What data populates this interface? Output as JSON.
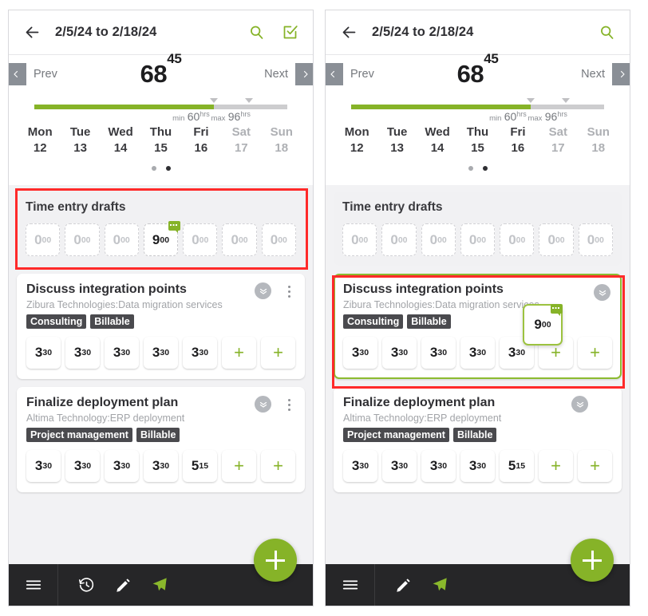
{
  "colors": {
    "accent_green": "#86b328",
    "highlight_red": "#ff2a2a",
    "drop_border_green": "#8cbb2f",
    "navbar_dark": "#262628",
    "tag_dark": "#4a4a4e"
  },
  "panels": [
    {
      "id": "left",
      "appbar": {
        "back_icon": "arrow-left-icon",
        "title": "2/5/24 to 2/18/24",
        "actions": [
          "search-icon",
          "submit-check-icon"
        ]
      },
      "summary": {
        "prev_label": "Prev",
        "next_label": "Next",
        "total_hours": "68",
        "total_minutes": "45",
        "progress_percent": 71,
        "min_prefix": "min",
        "min_value": "60",
        "min_unit": "hrs",
        "max_prefix": "max",
        "max_value": "96",
        "max_unit": "hrs",
        "days": [
          {
            "dow": "Mon",
            "num": "12",
            "weekend": false
          },
          {
            "dow": "Tue",
            "num": "13",
            "weekend": false
          },
          {
            "dow": "Wed",
            "num": "14",
            "weekend": false
          },
          {
            "dow": "Thu",
            "num": "15",
            "weekend": false
          },
          {
            "dow": "Fri",
            "num": "16",
            "weekend": false
          },
          {
            "dow": "Sat",
            "num": "17",
            "weekend": true
          },
          {
            "dow": "Sun",
            "num": "18",
            "weekend": true
          }
        ],
        "page_dots": 2,
        "active_dot": 1
      },
      "drafts": {
        "title": "Time entry drafts",
        "chips": [
          {
            "hours": "0",
            "minutes": "00",
            "filled": false,
            "badge": false
          },
          {
            "hours": "0",
            "minutes": "00",
            "filled": false,
            "badge": false
          },
          {
            "hours": "0",
            "minutes": "00",
            "filled": false,
            "badge": false
          },
          {
            "hours": "9",
            "minutes": "00",
            "filled": true,
            "badge": true
          },
          {
            "hours": "0",
            "minutes": "00",
            "filled": false,
            "badge": false
          },
          {
            "hours": "0",
            "minutes": "00",
            "filled": false,
            "badge": false
          },
          {
            "hours": "0",
            "minutes": "00",
            "filled": false,
            "badge": false
          }
        ]
      },
      "cards": [
        {
          "title": "Discuss integration points",
          "subtitle": "Zibura Technologies:Data migration services",
          "tags": [
            "Consulting",
            "Billable"
          ],
          "has_kebab": true,
          "drop_target": false,
          "slots": [
            {
              "hours": "3",
              "minutes": "30",
              "add": false
            },
            {
              "hours": "3",
              "minutes": "30",
              "add": false
            },
            {
              "hours": "3",
              "minutes": "30",
              "add": false
            },
            {
              "hours": "3",
              "minutes": "30",
              "add": false
            },
            {
              "hours": "3",
              "minutes": "30",
              "add": false
            },
            {
              "add": true,
              "label": "+"
            },
            {
              "add": true,
              "label": "+"
            }
          ]
        },
        {
          "title": "Finalize deployment plan",
          "subtitle": "Altima Technology:ERP deployment",
          "tags": [
            "Project management",
            "Billable"
          ],
          "has_kebab": true,
          "drop_target": false,
          "slots": [
            {
              "hours": "3",
              "minutes": "30",
              "add": false
            },
            {
              "hours": "3",
              "minutes": "30",
              "add": false
            },
            {
              "hours": "3",
              "minutes": "30",
              "add": false
            },
            {
              "hours": "3",
              "minutes": "30",
              "add": false
            },
            {
              "hours": "5",
              "minutes": "15",
              "add": false
            },
            {
              "add": true,
              "label": "+"
            },
            {
              "add": true,
              "label": "+"
            }
          ]
        }
      ],
      "bottom_nav": [
        "menu-icon",
        "history-icon",
        "pencil-icon",
        "send-icon"
      ],
      "fab_icon": "plus-icon",
      "drag_chip": null,
      "highlight_target": "drafts"
    },
    {
      "id": "right",
      "appbar": {
        "back_icon": "arrow-left-icon",
        "title": "2/5/24 to 2/18/24",
        "actions": [
          "search-icon"
        ]
      },
      "summary": {
        "prev_label": "Prev",
        "next_label": "Next",
        "total_hours": "68",
        "total_minutes": "45",
        "progress_percent": 71,
        "min_prefix": "min",
        "min_value": "60",
        "min_unit": "hrs",
        "max_prefix": "max",
        "max_value": "96",
        "max_unit": "hrs",
        "days": [
          {
            "dow": "Mon",
            "num": "12",
            "weekend": false
          },
          {
            "dow": "Tue",
            "num": "13",
            "weekend": false
          },
          {
            "dow": "Wed",
            "num": "14",
            "weekend": false
          },
          {
            "dow": "Thu",
            "num": "15",
            "weekend": false
          },
          {
            "dow": "Fri",
            "num": "16",
            "weekend": false
          },
          {
            "dow": "Sat",
            "num": "17",
            "weekend": true
          },
          {
            "dow": "Sun",
            "num": "18",
            "weekend": true
          }
        ],
        "page_dots": 2,
        "active_dot": 1
      },
      "drafts": {
        "title": "Time entry drafts",
        "chips": [
          {
            "hours": "0",
            "minutes": "00",
            "filled": false,
            "badge": false
          },
          {
            "hours": "0",
            "minutes": "00",
            "filled": false,
            "badge": false
          },
          {
            "hours": "0",
            "minutes": "00",
            "filled": false,
            "badge": false
          },
          {
            "hours": "0",
            "minutes": "00",
            "filled": false,
            "badge": false
          },
          {
            "hours": "0",
            "minutes": "00",
            "filled": false,
            "badge": false
          },
          {
            "hours": "0",
            "minutes": "00",
            "filled": false,
            "badge": false
          },
          {
            "hours": "0",
            "minutes": "00",
            "filled": false,
            "badge": false
          }
        ]
      },
      "cards": [
        {
          "title": "Discuss integration points",
          "subtitle": "Zibura Technologies:Data migration services",
          "tags": [
            "Consulting",
            "Billable"
          ],
          "has_kebab": false,
          "drop_target": true,
          "slots": [
            {
              "hours": "3",
              "minutes": "30",
              "add": false
            },
            {
              "hours": "3",
              "minutes": "30",
              "add": false
            },
            {
              "hours": "3",
              "minutes": "30",
              "add": false
            },
            {
              "hours": "3",
              "minutes": "30",
              "add": false
            },
            {
              "hours": "3",
              "minutes": "30",
              "add": false
            },
            {
              "add": true,
              "label": "+"
            },
            {
              "add": true,
              "label": "+"
            }
          ]
        },
        {
          "title": "Finalize deployment plan",
          "subtitle": "Altima Technology:ERP deployment",
          "tags": [
            "Project management",
            "Billable"
          ],
          "has_kebab": false,
          "drop_target": false,
          "slots": [
            {
              "hours": "3",
              "minutes": "30",
              "add": false
            },
            {
              "hours": "3",
              "minutes": "30",
              "add": false
            },
            {
              "hours": "3",
              "minutes": "30",
              "add": false
            },
            {
              "hours": "3",
              "minutes": "30",
              "add": false
            },
            {
              "hours": "5",
              "minutes": "15",
              "add": false
            },
            {
              "add": true,
              "label": "+"
            },
            {
              "add": true,
              "label": "+"
            }
          ]
        }
      ],
      "bottom_nav": [
        "menu-icon",
        "pencil-icon",
        "send-icon"
      ],
      "fab_icon": "plus-icon",
      "drag_chip": {
        "hours": "9",
        "minutes": "00",
        "badge": true
      },
      "highlight_target": "card0"
    }
  ]
}
